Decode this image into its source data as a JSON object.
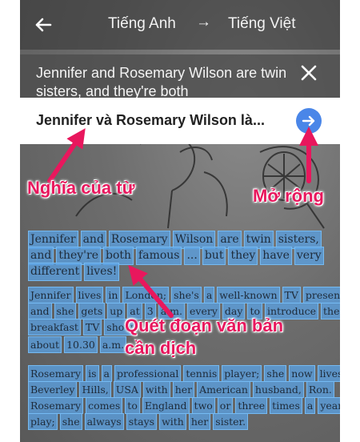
{
  "header": {
    "source_language": "Tiếng Anh",
    "arrow": "→",
    "target_language": "Tiếng Việt"
  },
  "source": {
    "text": "Jennifer and Rosemary Wilson are twin sisters, and they're both"
  },
  "translation": {
    "text": "Jennifer và Rosemary Wilson là..."
  },
  "annotations": {
    "meaning": "Nghĩa của từ",
    "expand": "Mở rộng",
    "scan_line1": "Quét đoạn văn bản",
    "scan_line2": "cần dịch"
  },
  "ocr_lines": [
    [
      "Jennifer",
      "and",
      "Rosemary",
      "Wilson",
      "are",
      "twin",
      "sisters,"
    ],
    [
      "and",
      "they're",
      "both",
      "famous",
      "...",
      "but",
      "they",
      "have",
      "very"
    ],
    [
      "different",
      "lives!"
    ],
    [
      "Jennifer",
      "lives",
      "in",
      "London;",
      "she's",
      "a",
      "well-known",
      "TV",
      "presenter"
    ],
    [
      "and",
      "she",
      "gets",
      "up",
      "at",
      "3",
      "a.m.",
      "every",
      "day",
      "to",
      "introduce",
      "the",
      "popular"
    ],
    [
      "breakfast",
      "TV",
      "show"
    ],
    [
      "about",
      "10.30",
      "a.m."
    ],
    [
      "Rosemary",
      "is",
      "a",
      "professional",
      "tennis",
      "player;",
      "she",
      "now",
      "lives",
      "in"
    ],
    [
      "Beverley",
      "Hills,",
      "USA",
      "with",
      "her",
      "American",
      "husband,",
      "Ron."
    ],
    [
      "Rosemary",
      "comes",
      "to",
      "England",
      "two",
      "or",
      "three",
      "times",
      "a",
      "year",
      "to"
    ],
    [
      "play;",
      "she",
      "always",
      "stays",
      "with",
      "her",
      "sister."
    ]
  ],
  "colors": {
    "annotation": "#e8175d",
    "expand_button": "#4a86e8",
    "highlight": "#5aa0e1"
  }
}
